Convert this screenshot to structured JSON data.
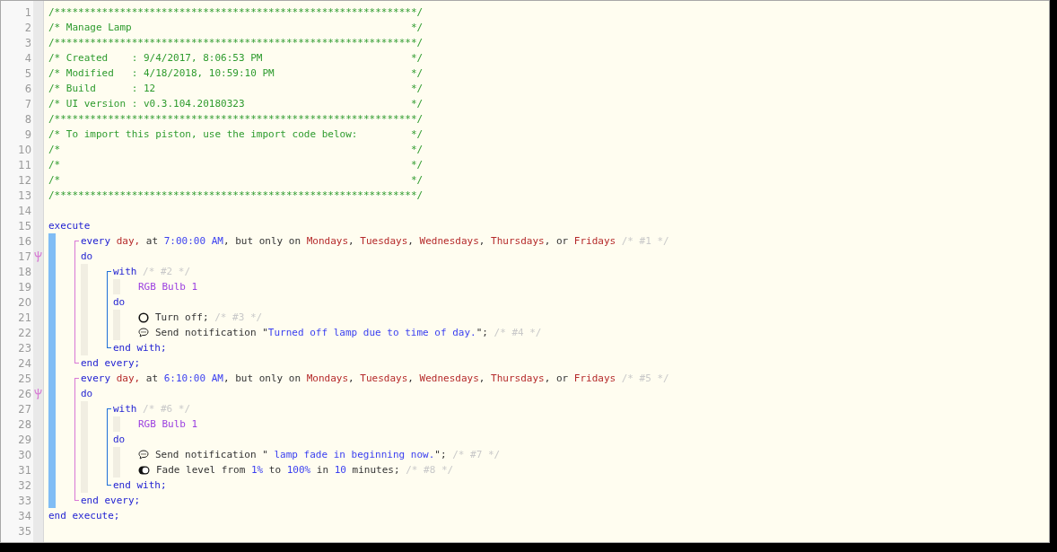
{
  "line_numbers": [
    "1",
    "2",
    "3",
    "4",
    "5",
    "6",
    "7",
    "8",
    "9",
    "10",
    "11",
    "12",
    "13",
    "14",
    "15",
    "16",
    "17",
    "18",
    "19",
    "20",
    "21",
    "22",
    "23",
    "24",
    "25",
    "26",
    "27",
    "28",
    "29",
    "30",
    "31",
    "32",
    "33",
    "34",
    "35"
  ],
  "header_comment": [
    {
      "text": "/*************************************************************/"
    },
    {
      "text": "/* Manage Lamp",
      "end": "*/"
    },
    {
      "text": "/*************************************************************/"
    },
    {
      "text": "/* Created    : 9/4/2017, 8:06:53 PM",
      "end": "*/"
    },
    {
      "text": "/* Modified   : 4/18/2018, 10:59:10 PM",
      "end": "*/"
    },
    {
      "text": "/* Build      : 12",
      "end": "*/"
    },
    {
      "text": "/* UI version : v0.3.104.20180323",
      "end": "*/"
    },
    {
      "text": "/*************************************************************/"
    },
    {
      "text": "/* To import this piston, use the import code below:",
      "end": "*/"
    },
    {
      "text": "/*",
      "end": "*/"
    },
    {
      "text": "/*",
      "end": "*/"
    },
    {
      "text": "/*",
      "end": "*/"
    },
    {
      "text": "/*************************************************************/"
    }
  ],
  "program": {
    "kind": "execute",
    "head": [
      {
        "kind": "keyword",
        "text": "execute"
      }
    ],
    "tail": [
      {
        "kind": "keyword",
        "text": "end execute;"
      }
    ],
    "sections": [
      {
        "children": [
          {
            "kind": "every",
            "head": [
              {
                "kind": "keyword",
                "text": "every"
              },
              {
                "kind": "day",
                "text": " day,"
              },
              {
                "kind": "plain",
                "text": " at "
              },
              {
                "kind": "value",
                "text": "7:00:00 AM"
              },
              {
                "kind": "plain",
                "text": ", but only on "
              },
              {
                "kind": "day",
                "text": "Mondays"
              },
              {
                "kind": "plain",
                "text": ", "
              },
              {
                "kind": "day",
                "text": "Tuesdays"
              },
              {
                "kind": "plain",
                "text": ", "
              },
              {
                "kind": "day",
                "text": "Wednesdays"
              },
              {
                "kind": "plain",
                "text": ", "
              },
              {
                "kind": "day",
                "text": "Thursdays"
              },
              {
                "kind": "plain",
                "text": ", or "
              },
              {
                "kind": "day",
                "text": "Fridays"
              },
              {
                "kind": "note",
                "text": " /* #1 */"
              }
            ],
            "tail": [
              {
                "kind": "keyword",
                "text": "end every;"
              }
            ],
            "sections": [
              {
                "label": [
                  {
                    "kind": "keyword",
                    "text": "do"
                  }
                ],
                "flagged": true,
                "children": [
                  {
                    "kind": "with",
                    "head": [
                      {
                        "kind": "keyword",
                        "text": "with"
                      },
                      {
                        "kind": "note",
                        "text": " /* #2 */"
                      }
                    ],
                    "tail": [
                      {
                        "kind": "keyword",
                        "text": "end with;"
                      }
                    ],
                    "sections": [
                      {
                        "children": [
                          {
                            "kind": "device",
                            "tokens": [
                              {
                                "kind": "device",
                                "text": "RGB Bulb 1"
                              }
                            ]
                          }
                        ]
                      },
                      {
                        "label": [
                          {
                            "kind": "keyword",
                            "text": "do"
                          }
                        ],
                        "flagged": false,
                        "children": [
                          {
                            "kind": "power",
                            "tokens": [
                              {
                                "kind": "plain",
                                "text": "Turn off; "
                              },
                              {
                                "kind": "note",
                                "text": "/* #3 */"
                              }
                            ]
                          },
                          {
                            "kind": "notify",
                            "tokens": [
                              {
                                "kind": "plain",
                                "text": "Send notification \""
                              },
                              {
                                "kind": "value",
                                "text": "Turned off lamp due to time of day."
                              },
                              {
                                "kind": "plain",
                                "text": "\"; "
                              },
                              {
                                "kind": "note",
                                "text": "/* #4 */"
                              }
                            ]
                          }
                        ]
                      }
                    ]
                  }
                ]
              }
            ]
          },
          {
            "kind": "every",
            "head": [
              {
                "kind": "keyword",
                "text": "every"
              },
              {
                "kind": "day",
                "text": " day,"
              },
              {
                "kind": "plain",
                "text": " at "
              },
              {
                "kind": "value",
                "text": "6:10:00 AM"
              },
              {
                "kind": "plain",
                "text": ", but only on "
              },
              {
                "kind": "day",
                "text": "Mondays"
              },
              {
                "kind": "plain",
                "text": ", "
              },
              {
                "kind": "day",
                "text": "Tuesdays"
              },
              {
                "kind": "plain",
                "text": ", "
              },
              {
                "kind": "day",
                "text": "Wednesdays"
              },
              {
                "kind": "plain",
                "text": ", "
              },
              {
                "kind": "day",
                "text": "Thursdays"
              },
              {
                "kind": "plain",
                "text": ", or "
              },
              {
                "kind": "day",
                "text": "Fridays"
              },
              {
                "kind": "note",
                "text": " /* #5 */"
              }
            ],
            "tail": [
              {
                "kind": "keyword",
                "text": "end every;"
              }
            ],
            "sections": [
              {
                "label": [
                  {
                    "kind": "keyword",
                    "text": "do"
                  }
                ],
                "flagged": true,
                "children": [
                  {
                    "kind": "with",
                    "head": [
                      {
                        "kind": "keyword",
                        "text": "with"
                      },
                      {
                        "kind": "note",
                        "text": " /* #6 */"
                      }
                    ],
                    "tail": [
                      {
                        "kind": "keyword",
                        "text": "end with;"
                      }
                    ],
                    "sections": [
                      {
                        "children": [
                          {
                            "kind": "device",
                            "tokens": [
                              {
                                "kind": "device",
                                "text": "RGB Bulb 1"
                              }
                            ]
                          }
                        ]
                      },
                      {
                        "label": [
                          {
                            "kind": "keyword",
                            "text": "do"
                          }
                        ],
                        "flagged": false,
                        "children": [
                          {
                            "kind": "notify",
                            "tokens": [
                              {
                                "kind": "plain",
                                "text": "Send notification \""
                              },
                              {
                                "kind": "value",
                                "text": " lamp fade in beginning now."
                              },
                              {
                                "kind": "plain",
                                "text": "\"; "
                              },
                              {
                                "kind": "note",
                                "text": "/* #7 */"
                              }
                            ]
                          },
                          {
                            "kind": "fade",
                            "tokens": [
                              {
                                "kind": "plain",
                                "text": "Fade level from "
                              },
                              {
                                "kind": "value",
                                "text": "1%"
                              },
                              {
                                "kind": "plain",
                                "text": " to "
                              },
                              {
                                "kind": "value",
                                "text": "100%"
                              },
                              {
                                "kind": "plain",
                                "text": " in "
                              },
                              {
                                "kind": "value",
                                "text": "10"
                              },
                              {
                                "kind": "plain",
                                "text": " minutes; "
                              },
                              {
                                "kind": "note",
                                "text": "/* #8 */"
                              }
                            ]
                          }
                        ]
                      }
                    ]
                  }
                ]
              }
            ]
          }
        ]
      }
    ]
  }
}
